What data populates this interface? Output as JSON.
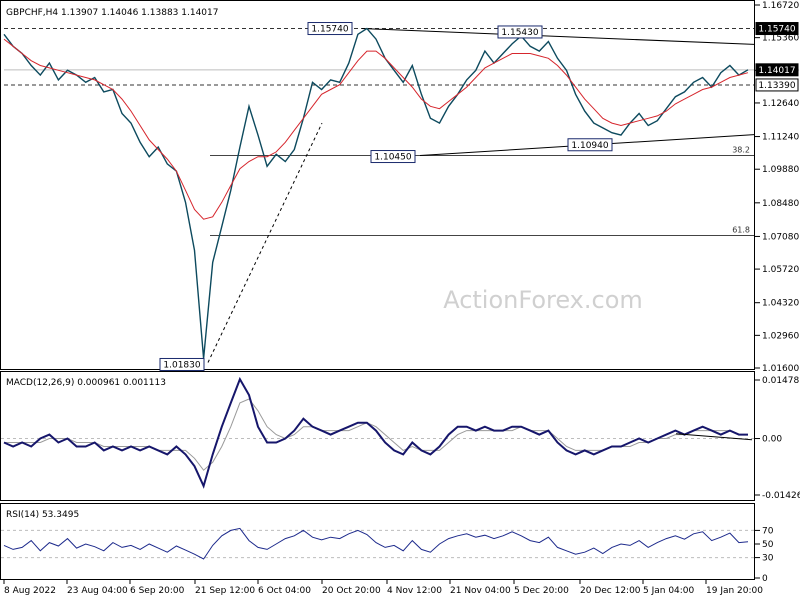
{
  "symbol_header": "GBPCHF,H4  1.13907 1.14046 1.13883 1.14017",
  "watermark": "ActionForex.com",
  "colors": {
    "price": "#0d4a5e",
    "ma": "#d6262d",
    "macd": "#16166b",
    "signal": "#9a9a9a",
    "rsi": "#1d2a8c",
    "grid": "#bdbdbd",
    "trend": "#000000",
    "watermark": "#d0d0d0",
    "tag_bg": "#000000"
  },
  "chart_data": [
    {
      "type": "line",
      "panel": "price",
      "title": "GBPCHF,H4",
      "x_tick_labels": [
        "8 Aug 2022",
        "23 Aug 04:00",
        "6 Sep 20:00",
        "21 Sep 12:00",
        "6 Oct 04:00",
        "20 Oct 20:00",
        "4 Nov 12:00",
        "21 Nov 04:00",
        "5 Dec 20:00",
        "20 Dec 12:00",
        "5 Jan 04:00",
        "19 Jan 20:00"
      ],
      "y_tick_labels": [
        "1.16720",
        "1.15360",
        "1.14000",
        "1.12640",
        "1.11240",
        "1.09880",
        "1.08480",
        "1.07080",
        "1.05720",
        "1.04320",
        "1.02960",
        "1.01600"
      ],
      "ylim": [
        1.016,
        1.1672
      ],
      "series": [
        {
          "values": [
            1.155,
            1.15,
            1.147,
            1.142,
            1.138,
            1.143,
            1.136,
            1.14,
            1.138,
            1.135,
            1.137,
            1.131,
            1.132,
            1.122,
            1.118,
            1.11,
            1.104,
            1.108,
            1.101,
            1.098,
            1.085,
            1.065,
            1.02,
            1.06,
            1.075,
            1.09,
            1.108,
            1.125,
            1.113,
            1.1,
            1.105,
            1.102,
            1.107,
            1.12,
            1.135,
            1.132,
            1.136,
            1.135,
            1.143,
            1.155,
            1.1574,
            1.153,
            1.145,
            1.14,
            1.135,
            1.142,
            1.13,
            1.12,
            1.118,
            1.125,
            1.13,
            1.136,
            1.14,
            1.148,
            1.143,
            1.147,
            1.151,
            1.1543,
            1.15,
            1.148,
            1.152,
            1.145,
            1.14,
            1.13,
            1.123,
            1.118,
            1.116,
            1.114,
            1.113,
            1.118,
            1.122,
            1.117,
            1.119,
            1.124,
            1.129,
            1.131,
            1.135,
            1.137,
            1.133,
            1.139,
            1.142,
            1.138,
            1.1402
          ]
        },
        {
          "values": [
            1.153,
            1.15,
            1.147,
            1.144,
            1.142,
            1.141,
            1.14,
            1.139,
            1.138,
            1.137,
            1.136,
            1.134,
            1.132,
            1.128,
            1.123,
            1.117,
            1.111,
            1.107,
            1.103,
            1.098,
            1.09,
            1.082,
            1.078,
            1.079,
            1.085,
            1.092,
            1.099,
            1.102,
            1.104,
            1.104,
            1.106,
            1.11,
            1.115,
            1.12,
            1.125,
            1.13,
            1.132,
            1.134,
            1.139,
            1.144,
            1.148,
            1.148,
            1.145,
            1.141,
            1.137,
            1.133,
            1.128,
            1.125,
            1.124,
            1.127,
            1.13,
            1.133,
            1.137,
            1.141,
            1.143,
            1.145,
            1.147,
            1.147,
            1.147,
            1.146,
            1.145,
            1.142,
            1.138,
            1.133,
            1.128,
            1.124,
            1.12,
            1.118,
            1.117,
            1.118,
            1.119,
            1.12,
            1.121,
            1.123,
            1.126,
            1.128,
            1.13,
            1.132,
            1.133,
            1.135,
            1.137,
            1.138,
            1.139
          ]
        }
      ],
      "price_tags": [
        {
          "text": "1.15740",
          "value": 1.1574,
          "style": "dark"
        },
        {
          "text": "1.14017",
          "value": 1.1402,
          "style": "dark"
        },
        {
          "text": "1.13390",
          "value": 1.1339,
          "style": "light"
        }
      ],
      "point_labels": [
        "1.15740",
        "1.15430",
        "1.10450",
        "1.10940",
        "1.01830"
      ],
      "fib_labels": [
        "38.2",
        "61.8"
      ]
    },
    {
      "type": "line",
      "panel": "macd",
      "title": "MACD(12,26,9) 0.000961 0.001113",
      "y_tick_labels": [
        "0.014787",
        "0.00",
        "-0.014263"
      ],
      "ylim": [
        -0.014263,
        0.014787
      ],
      "series": [
        {
          "values": [
            -0.001,
            -0.002,
            -0.001,
            -0.002,
            0.0,
            0.001,
            -0.001,
            0.0,
            -0.002,
            -0.002,
            -0.001,
            -0.003,
            -0.002,
            -0.003,
            -0.002,
            -0.003,
            -0.002,
            -0.003,
            -0.004,
            -0.002,
            -0.004,
            -0.007,
            -0.012,
            -0.004,
            0.003,
            0.009,
            0.015,
            0.011,
            0.003,
            -0.001,
            -0.001,
            0.0,
            0.002,
            0.005,
            0.003,
            0.002,
            0.001,
            0.002,
            0.003,
            0.004,
            0.004,
            0.002,
            -0.001,
            -0.003,
            -0.004,
            -0.001,
            -0.003,
            -0.004,
            -0.002,
            0.001,
            0.003,
            0.003,
            0.002,
            0.003,
            0.002,
            0.002,
            0.003,
            0.003,
            0.002,
            0.001,
            0.002,
            -0.001,
            -0.003,
            -0.004,
            -0.003,
            -0.004,
            -0.003,
            -0.002,
            -0.002,
            -0.001,
            0.0,
            -0.001,
            0.0,
            0.001,
            0.002,
            0.001,
            0.002,
            0.003,
            0.002,
            0.001,
            0.002,
            0.001,
            0.001
          ]
        },
        {
          "values": [
            -0.001,
            -0.001,
            -0.001,
            -0.001,
            -0.001,
            0.0,
            0.0,
            0.0,
            -0.001,
            -0.001,
            -0.001,
            -0.002,
            -0.002,
            -0.002,
            -0.002,
            -0.002,
            -0.002,
            -0.003,
            -0.003,
            -0.003,
            -0.003,
            -0.005,
            -0.008,
            -0.006,
            -0.002,
            0.003,
            0.009,
            0.01,
            0.007,
            0.003,
            0.001,
            0.0,
            0.001,
            0.003,
            0.003,
            0.002,
            0.002,
            0.002,
            0.002,
            0.003,
            0.004,
            0.003,
            0.001,
            -0.001,
            -0.003,
            -0.002,
            -0.003,
            -0.003,
            -0.003,
            -0.001,
            0.001,
            0.002,
            0.002,
            0.002,
            0.002,
            0.002,
            0.002,
            0.003,
            0.002,
            0.002,
            0.002,
            0.0,
            -0.002,
            -0.003,
            -0.003,
            -0.003,
            -0.003,
            -0.002,
            -0.002,
            -0.002,
            -0.001,
            -0.001,
            0.0,
            0.0,
            0.001,
            0.001,
            0.002,
            0.002,
            0.002,
            0.002,
            0.002,
            0.001,
            0.001
          ]
        }
      ]
    },
    {
      "type": "line",
      "panel": "rsi",
      "title": "RSI(14) 53.3495",
      "y_tick_labels": [
        "70",
        "50",
        "30",
        "0"
      ],
      "reference_levels": [
        70,
        30
      ],
      "ylim": [
        0,
        100
      ],
      "series": [
        {
          "values": [
            48,
            42,
            45,
            55,
            40,
            52,
            47,
            58,
            44,
            50,
            46,
            40,
            52,
            45,
            48,
            42,
            50,
            44,
            38,
            47,
            41,
            35,
            28,
            48,
            62,
            70,
            73,
            55,
            45,
            42,
            50,
            58,
            62,
            70,
            60,
            56,
            60,
            58,
            65,
            70,
            64,
            52,
            45,
            48,
            40,
            55,
            42,
            38,
            50,
            58,
            62,
            65,
            60,
            63,
            58,
            62,
            68,
            62,
            55,
            52,
            60,
            45,
            40,
            35,
            38,
            44,
            36,
            45,
            50,
            48,
            55,
            45,
            52,
            58,
            62,
            57,
            65,
            68,
            55,
            60,
            66,
            52,
            53.35
          ]
        }
      ]
    }
  ]
}
